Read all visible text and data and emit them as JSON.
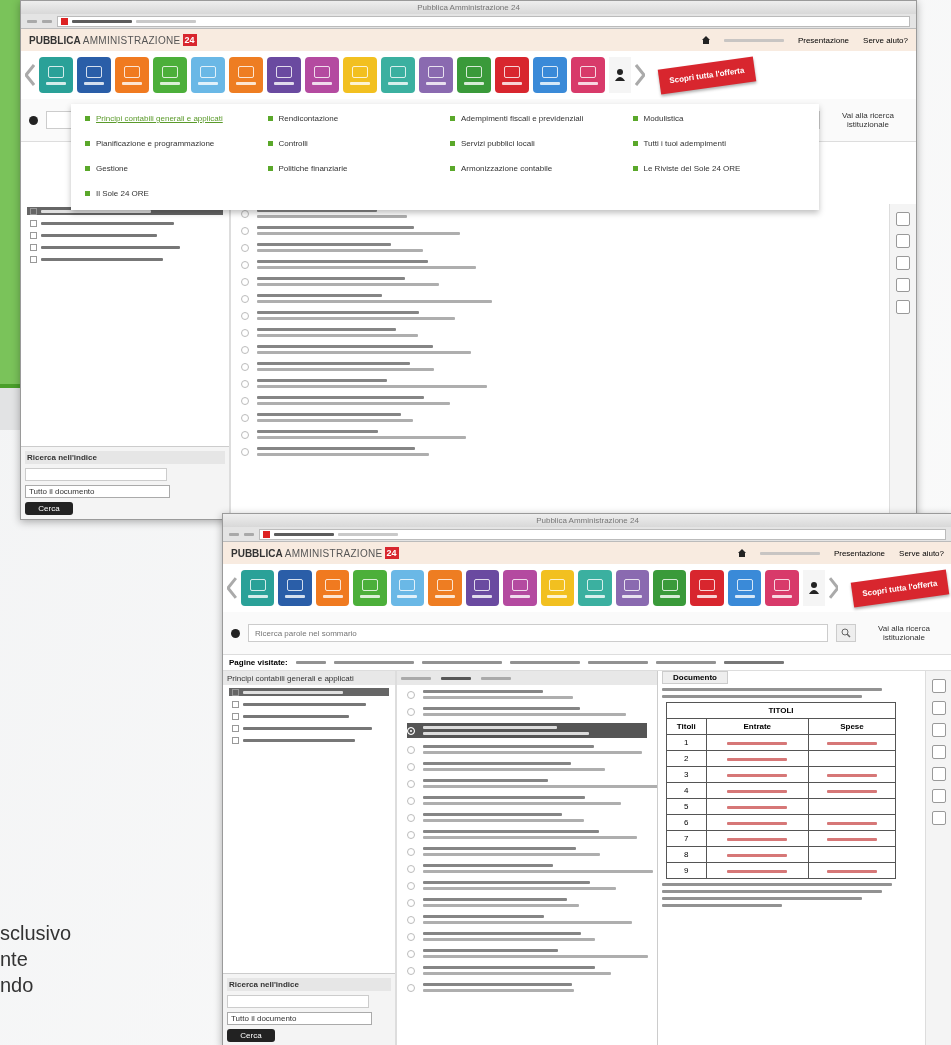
{
  "caption": {
    "lines": [
      "sclusivo",
      "nte",
      "ndo"
    ]
  },
  "window_1": {
    "app": {
      "title": "Pubblica Amministrazione 24",
      "logo_bold": "PUBBLICA",
      "logo_light": "AMMINISTRAZIONE",
      "logo_badge": "24",
      "links": [
        "Presentazione",
        "Serve aiuto?"
      ],
      "banner": "Scopri tutta l'offerta",
      "institutional": "Vai alla ricerca istituzionale",
      "tiles": [
        {
          "color": "#2aa198"
        },
        {
          "color": "#2a5ea8"
        },
        {
          "color": "#f07a20"
        },
        {
          "color": "#4caf3a"
        },
        {
          "color": "#6ab8e6"
        },
        {
          "color": "#ee7d22"
        },
        {
          "color": "#6a4aa0"
        },
        {
          "color": "#b44aa0"
        },
        {
          "color": "#f2c020"
        },
        {
          "color": "#3bb0a0"
        },
        {
          "color": "#8a6ab0"
        },
        {
          "color": "#3a9a3a"
        },
        {
          "color": "#d8262e"
        },
        {
          "color": "#3a8ad8"
        },
        {
          "color": "#d83a6a"
        }
      ]
    },
    "menu": [
      {
        "label": "Principi contabili generali e applicati",
        "selected": true
      },
      {
        "label": "Rendicontazione",
        "selected": false
      },
      {
        "label": "Adempimenti fiscali e previdenziali",
        "selected": false
      },
      {
        "label": "Modulistica",
        "selected": false
      },
      {
        "label": "Pianificazione e programmazione",
        "selected": false
      },
      {
        "label": "Controlli",
        "selected": false
      },
      {
        "label": "Servizi pubblici locali",
        "selected": false
      },
      {
        "label": "Tutti i tuoi adempimenti",
        "selected": false
      },
      {
        "label": "Gestione",
        "selected": false
      },
      {
        "label": "Politiche finanziarie",
        "selected": false
      },
      {
        "label": "Armonizzazione contabile",
        "selected": false
      },
      {
        "label": "Le Riviste del Sole 24 ORE",
        "selected": false
      },
      {
        "label": "Il Sole 24 ORE",
        "selected": false
      }
    ],
    "tree": [
      {
        "selected": true
      },
      {
        "selected": false
      },
      {
        "selected": false
      },
      {
        "selected": false
      },
      {
        "selected": false
      }
    ],
    "rows": [
      {
        "selected": false
      },
      {
        "selected": false
      },
      {
        "selected": false
      },
      {
        "selected": false
      },
      {
        "selected": false
      },
      {
        "selected": false
      },
      {
        "selected": false
      },
      {
        "selected": false
      },
      {
        "selected": false
      },
      {
        "selected": false
      },
      {
        "selected": false
      },
      {
        "selected": false
      },
      {
        "selected": false
      },
      {
        "selected": false
      },
      {
        "selected": false
      }
    ],
    "index_search": {
      "title": "Ricerca nell'indice",
      "scope": "Tutto il documento",
      "button": "Cerca"
    }
  },
  "window_2": {
    "app": {
      "title": "Pubblica Amministrazione 24",
      "logo_bold": "PUBBLICA",
      "logo_light": "AMMINISTRAZIONE",
      "logo_badge": "24",
      "links": [
        "Presentazione",
        "Serve aiuto?"
      ],
      "banner": "Scopri tutta l'offerta",
      "institutional": "Vai alla ricerca istituzionale",
      "tiles": [
        {
          "color": "#2aa198"
        },
        {
          "color": "#2a5ea8"
        },
        {
          "color": "#f07a20"
        },
        {
          "color": "#4caf3a"
        },
        {
          "color": "#6ab8e6"
        },
        {
          "color": "#ee7d22"
        },
        {
          "color": "#6a4aa0"
        },
        {
          "color": "#b44aa0"
        },
        {
          "color": "#f2c020"
        },
        {
          "color": "#3bb0a0"
        },
        {
          "color": "#8a6ab0"
        },
        {
          "color": "#3a9a3a"
        },
        {
          "color": "#d8262e"
        },
        {
          "color": "#3a8ad8"
        },
        {
          "color": "#d83a6a"
        }
      ]
    },
    "search_placeholder": "Ricerca parole nel sommario",
    "visited_label": "Pagine visitate:",
    "tree_title": "Principi contabili generali e applicati",
    "doc_tab": "Documento",
    "tree": [
      {
        "selected": true
      },
      {
        "selected": false
      },
      {
        "selected": false
      },
      {
        "selected": false
      },
      {
        "selected": false
      }
    ],
    "rows": [
      {
        "selected": false
      },
      {
        "selected": false
      },
      {
        "selected": true
      },
      {
        "selected": false
      },
      {
        "selected": false
      },
      {
        "selected": false
      },
      {
        "selected": false
      },
      {
        "selected": false
      },
      {
        "selected": false
      },
      {
        "selected": false
      },
      {
        "selected": false
      },
      {
        "selected": false
      },
      {
        "selected": false
      },
      {
        "selected": false
      },
      {
        "selected": false
      },
      {
        "selected": false
      },
      {
        "selected": false
      },
      {
        "selected": false
      }
    ],
    "table": {
      "title": "TITOLI",
      "columns": [
        "Titoli",
        "Entrate",
        "Spese"
      ],
      "rows": [
        "1",
        "2",
        "3",
        "4",
        "5",
        "6",
        "7",
        "8",
        "9"
      ]
    },
    "index_search": {
      "title": "Ricerca nell'indice",
      "scope": "Tutto il documento",
      "button": "Cerca"
    }
  }
}
